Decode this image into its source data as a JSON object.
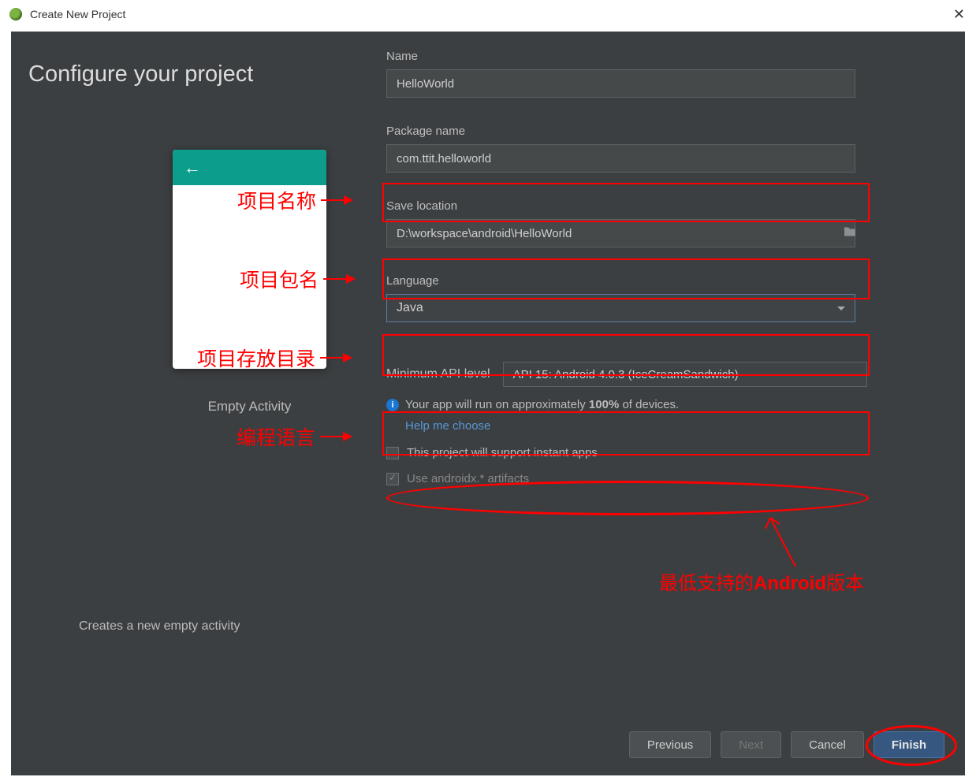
{
  "window": {
    "title": "Create New Project"
  },
  "page": {
    "heading": "Configure your project"
  },
  "preview": {
    "name": "Empty Activity"
  },
  "form": {
    "name": {
      "label": "Name",
      "value": "HelloWorld"
    },
    "package": {
      "label": "Package name",
      "value": "com.ttit.helloworld"
    },
    "location": {
      "label": "Save location",
      "value": "D:\\workspace\\android\\HelloWorld"
    },
    "language": {
      "label": "Language",
      "value": "Java"
    },
    "api": {
      "label": "Minimum API level",
      "value": "API 15: Android 4.0.3 (IceCreamSandwich)"
    },
    "info_prefix": "Your app will run on approximately ",
    "info_percent": "100%",
    "info_suffix": " of devices.",
    "help_link": "Help me choose",
    "check_instant": "This project will support instant apps",
    "check_androidx": "Use androidx.* artifacts"
  },
  "description": "Creates a new empty activity",
  "buttons": {
    "previous": "Previous",
    "next": "Next",
    "cancel": "Cancel",
    "finish": "Finish"
  },
  "annotations": {
    "name": "项目名称",
    "package": "项目包名",
    "location": "项目存放目录",
    "language": "编程语言",
    "api_prefix": "最低支持的",
    "api_bold": "Android",
    "api_suffix": "版本"
  }
}
